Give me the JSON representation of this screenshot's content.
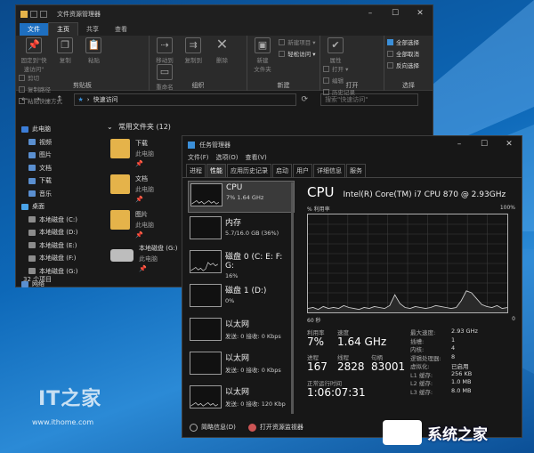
{
  "explorer": {
    "title": "文件资源管理器",
    "tabs": [
      "文件",
      "主页",
      "共享",
      "查看"
    ],
    "ribbon": {
      "clipboard": {
        "label": "剪贴板",
        "pin": "固定到\"快速访问\"",
        "copy": "复制",
        "paste": "粘贴",
        "cut": "剪切",
        "copy_path": "复制路径",
        "paste_shortcut": "粘贴快捷方式"
      },
      "organize": {
        "label": "组织",
        "move_to": "移动到",
        "copy_to": "复制到",
        "delete": "删除",
        "rename": "重命名"
      },
      "new": {
        "label": "新建",
        "new_folder": "新建\n文件夹",
        "new_item": "新建项目 ▾",
        "easy_access": "轻松访问 ▾"
      },
      "open": {
        "label": "打开",
        "properties": "属性",
        "open": "打开 ▾",
        "edit": "编辑",
        "history": "历史记录"
      },
      "select": {
        "label": "选择",
        "select_all": "全部选择",
        "select_none": "全部取消",
        "invert": "反向选择"
      }
    },
    "address": "快速访问",
    "search_placeholder": "搜索\"快速访问\"",
    "nav": [
      {
        "label": "此电脑",
        "kind": "pc"
      },
      {
        "label": "视频",
        "kind": "folder"
      },
      {
        "label": "图片",
        "kind": "folder"
      },
      {
        "label": "文档",
        "kind": "folder"
      },
      {
        "label": "下载",
        "kind": "folder"
      },
      {
        "label": "音乐",
        "kind": "folder"
      },
      {
        "label": "桌面",
        "kind": "dsk"
      },
      {
        "label": "本地磁盘 (C:)",
        "kind": "drv"
      },
      {
        "label": "本地磁盘 (D:)",
        "kind": "drv"
      },
      {
        "label": "本地磁盘 (E:)",
        "kind": "drv"
      },
      {
        "label": "本地磁盘 (F:)",
        "kind": "drv"
      },
      {
        "label": "本地磁盘 (G:)",
        "kind": "drv"
      },
      {
        "label": "网络",
        "kind": "folder"
      }
    ],
    "section": "常用文件夹 (12)",
    "items": [
      {
        "name": "下载",
        "sub": "此电脑"
      },
      {
        "name": "文档",
        "sub": "此电脑"
      },
      {
        "name": "图片",
        "sub": "此电脑"
      },
      {
        "name": "本地磁盘 (G:)",
        "sub": "此电脑"
      }
    ],
    "status": "32 个项目"
  },
  "taskmgr": {
    "title": "任务管理器",
    "menu": [
      "文件(F)",
      "选项(O)",
      "查看(V)"
    ],
    "tabs": [
      "进程",
      "性能",
      "应用历史记录",
      "启动",
      "用户",
      "详细信息",
      "服务"
    ],
    "side": [
      {
        "name": "CPU",
        "value": "7%  1.64 GHz"
      },
      {
        "name": "内存",
        "value": "5.7/16.0 GB (36%)"
      },
      {
        "name": "磁盘 0 (C: E: F: G:",
        "value": "16%"
      },
      {
        "name": "磁盘 1 (D:)",
        "value": "0%"
      },
      {
        "name": "以太网",
        "value": "发送: 0 接收: 0 Kbps"
      },
      {
        "name": "以太网",
        "value": "发送: 0 接收: 0 Kbps"
      },
      {
        "name": "以太网",
        "value": "发送: 0 接收: 120 Kbp"
      }
    ],
    "main": {
      "title": "CPU",
      "model": "Intel(R) Core(TM) i7 CPU 870 @ 2.93GHz",
      "util_label": "% 利用率",
      "max_label": "100%",
      "time_label": "60 秒",
      "zero_label": "0",
      "util_k": "利用率",
      "util_v": "7%",
      "speed_k": "速度",
      "speed_v": "1.64 GHz",
      "proc_k": "进程",
      "proc_v": "167",
      "thread_k": "线程",
      "thread_v": "2828",
      "handle_k": "句柄",
      "handle_v": "83001",
      "uptime_k": "正常运行时间",
      "uptime_v": "1:06:07:31",
      "specs": [
        {
          "k": "最大速度:",
          "v": "2.93 GHz"
        },
        {
          "k": "插槽:",
          "v": "1"
        },
        {
          "k": "内核:",
          "v": "4"
        },
        {
          "k": "逻辑处理器:",
          "v": "8"
        },
        {
          "k": "虚拟化:",
          "v": "已启用"
        },
        {
          "k": "L1 缓存:",
          "v": "256 KB"
        },
        {
          "k": "L2 缓存:",
          "v": "1.0 MB"
        },
        {
          "k": "L3 缓存:",
          "v": "8.0 MB"
        }
      ]
    },
    "footer": {
      "brief": "简略信息(D)",
      "resmon": "打开资源监视器"
    }
  },
  "cpu_series": [
    4,
    5,
    3,
    6,
    4,
    5,
    4,
    7,
    5,
    4,
    3,
    5,
    4,
    6,
    5,
    4,
    7,
    18,
    9,
    5,
    4,
    6,
    5,
    4,
    5,
    7,
    6,
    5,
    4,
    5,
    12,
    22,
    20,
    14,
    8,
    6,
    5,
    7,
    4,
    5
  ],
  "watermark": {
    "it": "IT之家",
    "url": "www.ithome.com",
    "logo": "系统之家"
  }
}
